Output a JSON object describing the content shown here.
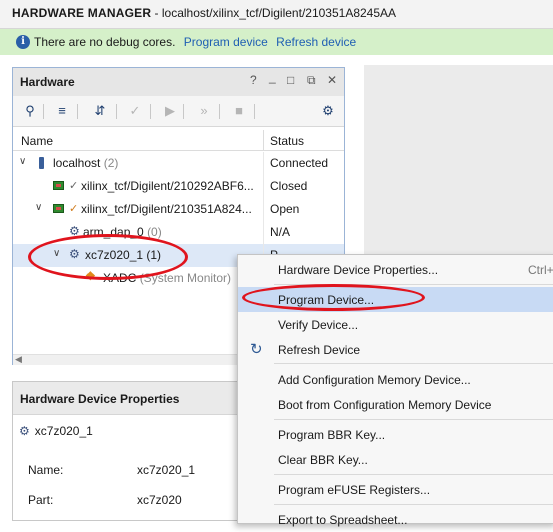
{
  "window": {
    "title_bold": "HARDWARE MANAGER",
    "title_rest": "localhost/xilinx_tcf/Digilent/210351A8245AA"
  },
  "infobar": {
    "message": "There are no debug cores.",
    "link_program": "Program device",
    "link_refresh": "Refresh device",
    "icon": "info-icon"
  },
  "hardware_panel": {
    "title": "Hardware",
    "controls": [
      "?",
      "_",
      "□",
      "⧉",
      "✕"
    ],
    "toolbar_icons": [
      "search-icon",
      "collapse-all-icon",
      "expand-icon",
      "auto-connect-icon",
      "run-icon",
      "run-all-icon",
      "stop-icon",
      "settings-icon"
    ],
    "columns": {
      "name": "Name",
      "status": "Status"
    },
    "rows": [
      {
        "name": "localhost",
        "count": "(2)",
        "status": "Connected"
      },
      {
        "name": "xilinx_tcf/Digilent/210292ABF6...",
        "count": "",
        "status": "Closed"
      },
      {
        "name": "xilinx_tcf/Digilent/210351A824...",
        "count": "",
        "status": "Open"
      },
      {
        "name": "arm_dap_0",
        "count": "(0)",
        "status": "N/A"
      },
      {
        "name": "xc7z020_1",
        "count": "(1)",
        "status": "P..."
      },
      {
        "name": "XADC",
        "count": "(System Monitor)",
        "status": ""
      }
    ]
  },
  "properties_panel": {
    "title": "Hardware Device Properties",
    "device": "xc7z020_1",
    "fields": [
      {
        "label": "Name:",
        "value": "xc7z020_1"
      },
      {
        "label": "Part:",
        "value": "xc7z020"
      }
    ]
  },
  "context_menu": {
    "items": [
      {
        "label": "Hardware Device Properties...",
        "shortcut": "Ctrl+"
      },
      {
        "label": "Program Device...",
        "shortcut": ""
      },
      {
        "label": "Verify Device...",
        "shortcut": ""
      },
      {
        "label": "Refresh Device",
        "shortcut": ""
      },
      {
        "label": "Add Configuration Memory Device...",
        "shortcut": ""
      },
      {
        "label": "Boot from Configuration Memory Device",
        "shortcut": ""
      },
      {
        "label": "Program BBR Key...",
        "shortcut": ""
      },
      {
        "label": "Clear BBR Key...",
        "shortcut": ""
      },
      {
        "label": "Program eFUSE Registers...",
        "shortcut": ""
      },
      {
        "label": "Export to Spreadsheet...",
        "shortcut": ""
      }
    ],
    "highlighted": "Program Device..."
  },
  "colors": {
    "infobar_bg": "#d5f0c9",
    "link": "#1f5fb3",
    "highlight": "#c8daf4",
    "annotation": "#e0141d"
  }
}
